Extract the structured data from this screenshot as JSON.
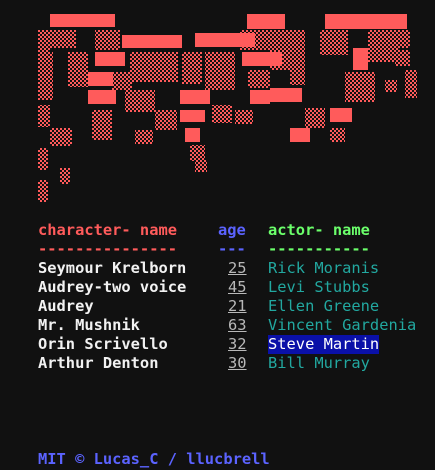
{
  "banner": {
    "art_name": "cast-ascii-banner",
    "colors": {
      "solid": "#ff5b5b",
      "dotted": "#ff5b5b"
    }
  },
  "table": {
    "headers": {
      "character": "character- name",
      "age": "age",
      "actor": "actor- name"
    },
    "separators": {
      "character": "---------------",
      "age": "---",
      "actor": "-----------"
    },
    "rows": [
      {
        "character": "Seymour Krelborn",
        "age": "25",
        "actor": "Rick Moranis",
        "selected": false
      },
      {
        "character": "Audrey-two voice",
        "age": "45",
        "actor": "Levi Stubbs",
        "selected": false
      },
      {
        "character": "Audrey",
        "age": "21",
        "actor": "Ellen Greene",
        "selected": false
      },
      {
        "character": "Mr. Mushnik",
        "age": "63",
        "actor": "Vincent Gardenia",
        "selected": false
      },
      {
        "character": "Orin Scrivello",
        "age": "32",
        "actor": "Steve Martin",
        "selected": true
      },
      {
        "character": "Arthur Denton",
        "age": "30",
        "actor": "Bill Murray",
        "selected": false
      }
    ]
  },
  "footer": {
    "text": "MIT © Lucas_C / llucbrell"
  },
  "colors": {
    "background": "#111111",
    "header_character": "#ff5b5b",
    "header_age": "#5b63ff",
    "header_actor": "#6bff6b",
    "cell_character": "#f2f2f2",
    "cell_age": "#b8b8b8",
    "cell_actor": "#22a8a0",
    "selection_bg": "#0a10a8",
    "footer": "#5b63ff"
  }
}
